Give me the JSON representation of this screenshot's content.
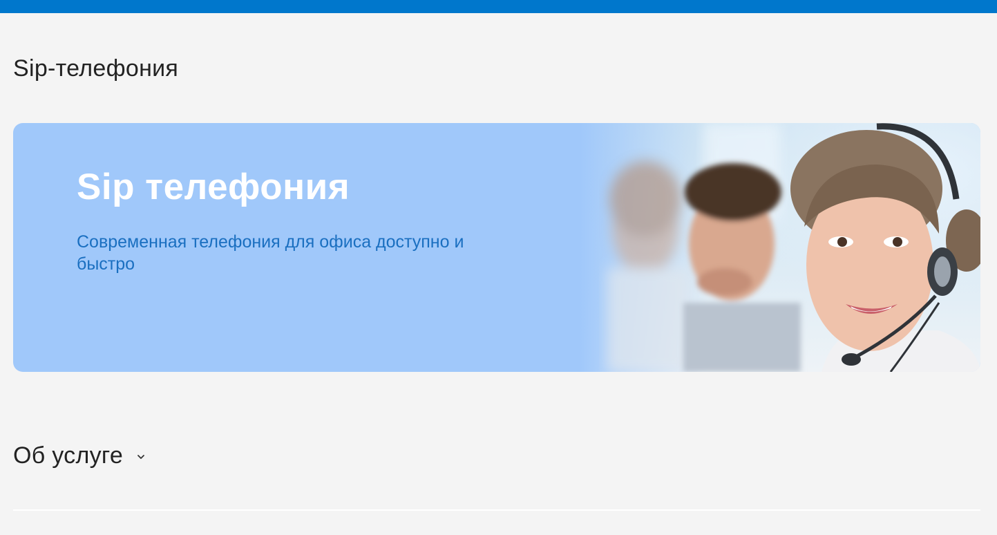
{
  "colors": {
    "top_bar": "#0077cc",
    "page_background": "#f4f4f4",
    "banner_background": "#a0c8fa",
    "banner_heading": "#ffffff",
    "banner_subtitle": "#1a6fc0"
  },
  "page": {
    "title": "Sip-телефония"
  },
  "banner": {
    "heading": "Sip телефония",
    "subtitle": "Современная телефония для офиса доступно и быстро",
    "image": "call-center-operators-photo"
  },
  "sections": [
    {
      "title": "Об услуге",
      "icon": "chevron-down-icon",
      "expanded": false
    }
  ]
}
